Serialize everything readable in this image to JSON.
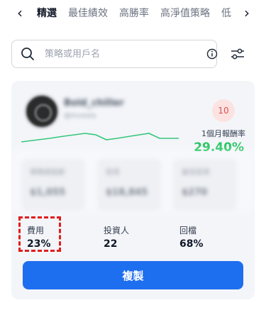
{
  "tabs": {
    "items": [
      "精選",
      "最佳績效",
      "高勝率",
      "高淨值策略",
      "低"
    ],
    "active_index": 0
  },
  "search": {
    "placeholder": "策略或用戶名",
    "value": ""
  },
  "card": {
    "name": "Bold_chiller",
    "handle": "@Invests",
    "rank_badge": "10",
    "roi_label": "1個月報酬率",
    "roi_value": "29.40%",
    "roi_color": "#22c55e",
    "blurred_stats": [
      {
        "label": "策略總盈虧",
        "value": "$1,055"
      },
      {
        "label": "投資",
        "value": "$18,845"
      },
      {
        "label": "最低投資",
        "value": "$270"
      }
    ],
    "metrics": [
      {
        "label": "費用",
        "value": "23%"
      },
      {
        "label": "投資人",
        "value": "22"
      },
      {
        "label": "回檔",
        "value": "68%"
      }
    ],
    "copy_button": "複製",
    "accent_color": "#1e6ef0"
  }
}
